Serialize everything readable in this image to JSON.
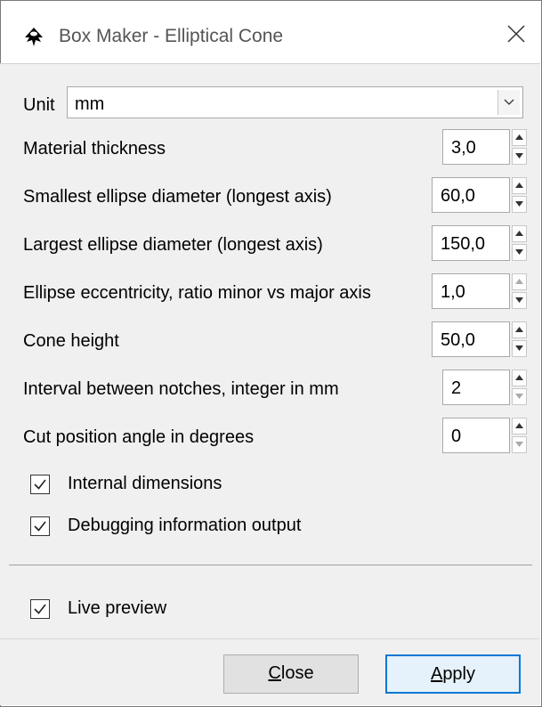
{
  "window": {
    "title": "Box Maker - Elliptical Cone",
    "icon": "inkscape-icon",
    "close_icon": "close-icon"
  },
  "unit": {
    "label": "Unit",
    "value": "mm",
    "dropdown_icon": "chevron-down-icon"
  },
  "params": [
    {
      "label": "Material thickness",
      "value": "3,0"
    },
    {
      "label": "Smallest ellipse diameter (longest axis)",
      "value": "60,0"
    },
    {
      "label": "Largest ellipse diameter (longest axis)",
      "value": "150,0"
    },
    {
      "label": "Ellipse eccentricity, ratio minor vs major axis",
      "value": "1,0"
    },
    {
      "label": "Cone height",
      "value": "50,0"
    },
    {
      "label": "Interval between notches, integer in mm",
      "value": "2"
    },
    {
      "label": "Cut position angle in degrees",
      "value": "0"
    }
  ],
  "options": [
    {
      "label": "Internal dimensions",
      "checked": true
    },
    {
      "label": "Debugging information output",
      "checked": true
    }
  ],
  "live_preview": {
    "label": "Live preview",
    "checked": true
  },
  "buttons": {
    "close_prefix": "",
    "close_mnemonic": "C",
    "close_rest": "lose",
    "apply_mnemonic": "A",
    "apply_rest": "pply"
  },
  "colors": {
    "accent": "#0078d7",
    "dialog_bg": "#f0f0f0"
  }
}
